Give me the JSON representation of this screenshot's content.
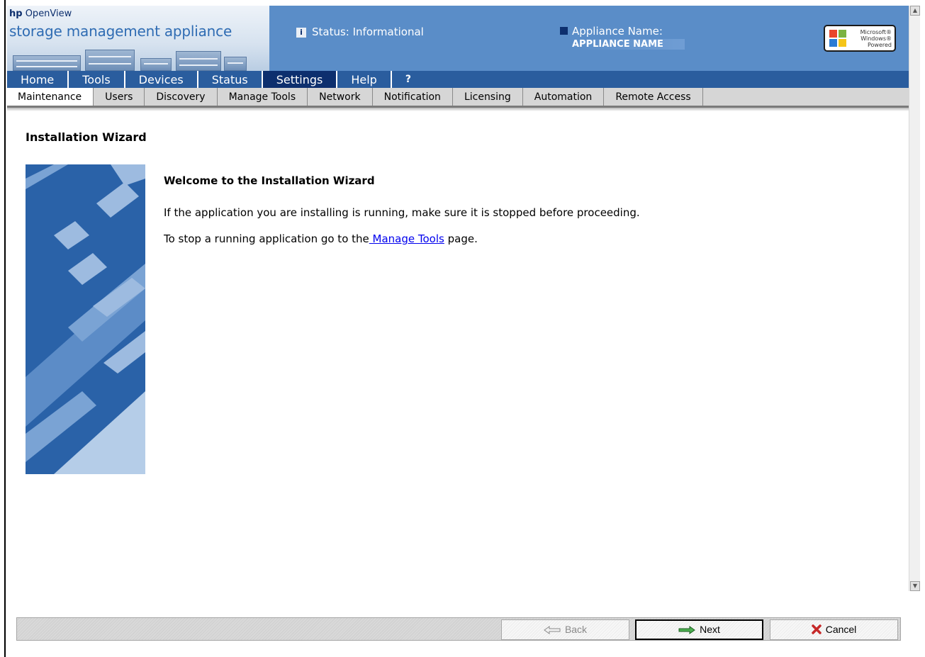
{
  "header": {
    "brand_hp": "hp",
    "brand_openview": "OpenView",
    "brand_product": "storage management appliance",
    "status_label": "Status: Informational",
    "appliance_label": "Appliance Name:",
    "appliance_value": "APPLIANCE NAME",
    "windows_logo_text": "Microsoft® Windows® Powered"
  },
  "top_nav": [
    "Home",
    "Tools",
    "Devices",
    "Status",
    "Settings",
    "Help",
    "?"
  ],
  "top_nav_active": "Settings",
  "sub_nav": [
    "Maintenance",
    "Users",
    "Discovery",
    "Manage Tools",
    "Network",
    "Notification",
    "Licensing",
    "Automation",
    "Remote Access"
  ],
  "sub_nav_active": "Maintenance",
  "main": {
    "title": "Installation Wizard",
    "welcome_heading": "Welcome to the Installation Wizard",
    "paragraph1": "If the application you are installing is running, make sure it is stopped before proceeding.",
    "paragraph2_prefix": "To stop a running application go to the",
    "paragraph2_link": " Manage Tools",
    "paragraph2_suffix": " page."
  },
  "buttons": {
    "back": "Back",
    "next": "Next",
    "cancel": "Cancel"
  },
  "colors": {
    "header_blue": "#5a8dc8",
    "nav_blue": "#2a5d9e",
    "nav_active": "#0d2f6e",
    "link": "#0000ee"
  }
}
